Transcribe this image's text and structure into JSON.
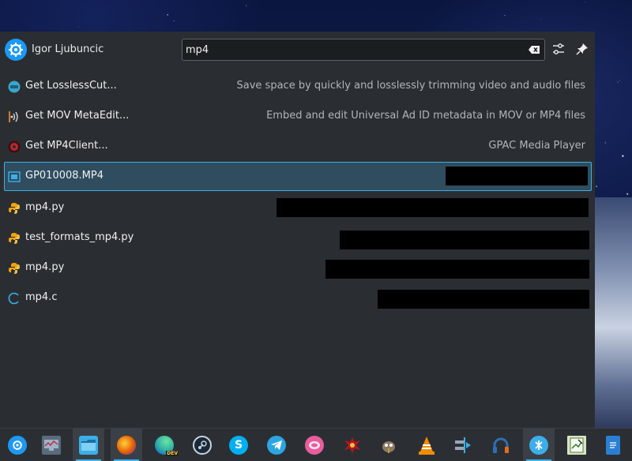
{
  "user": {
    "name": "Igor Ljubuncic"
  },
  "search": {
    "value": "mp4",
    "placeholder": ""
  },
  "results": [
    {
      "title": "Get LosslessCut...",
      "subtitle": "Save space by quickly and losslessly trimming video and audio files",
      "icon": "losslesscut-icon",
      "color": "#3aa6c9"
    },
    {
      "title": "Get MOV MetaEdit...",
      "subtitle": "Embed and edit Universal Ad ID metadata in MOV or MP4 files",
      "icon": "movmetaedit-icon",
      "color": "#8c8f93"
    },
    {
      "title": "Get MP4Client...",
      "subtitle": "GPAC Media Player",
      "icon": "gpac-icon",
      "color": "#c0262d"
    },
    {
      "title": "GP010008.MP4",
      "subtitle": "",
      "icon": "video-file-icon",
      "color": "#3daee9"
    },
    {
      "title": "mp4.py",
      "subtitle": "",
      "icon": "python-file-icon",
      "color": "#f0a30a"
    },
    {
      "title": "test_formats_mp4.py",
      "subtitle": "",
      "icon": "python-file-icon",
      "color": "#f0a30a"
    },
    {
      "title": "mp4.py",
      "subtitle": "",
      "icon": "python-file-icon",
      "color": "#f0a30a"
    },
    {
      "title": "mp4.c",
      "subtitle": "",
      "icon": "c-source-file-icon",
      "color": "#3daee9"
    }
  ],
  "taskbar": [
    {
      "icon": "kde-launcher-icon",
      "color": "#1d99f3",
      "glyph": ""
    },
    {
      "icon": "system-monitor-icon",
      "color": "#5a6b7c",
      "glyph": ""
    },
    {
      "icon": "file-manager-icon",
      "color": "#3daee9",
      "glyph": ""
    },
    {
      "icon": "firefox-icon",
      "color": "#e66000",
      "glyph": ""
    },
    {
      "icon": "edge-dev-icon",
      "color": "#2fb3a5",
      "glyph": "DEV"
    },
    {
      "icon": "steam-icon",
      "color": "#1b2838",
      "glyph": ""
    },
    {
      "icon": "skype-icon",
      "color": "#00aff0",
      "glyph": "S"
    },
    {
      "icon": "telegram-icon",
      "color": "#2ca5e0",
      "glyph": ""
    },
    {
      "icon": "chat-app-icon",
      "color": "#e85d9e",
      "glyph": ""
    },
    {
      "icon": "game-app-icon",
      "color": "#b3161d",
      "glyph": ""
    },
    {
      "icon": "gimp-icon",
      "color": "#6b5b45",
      "glyph": ""
    },
    {
      "icon": "vlc-icon",
      "color": "#f08c00",
      "glyph": ""
    },
    {
      "icon": "kdenlive-icon",
      "color": "#5b6f8a",
      "glyph": ""
    },
    {
      "icon": "headphones-app-icon",
      "color": "#2d6fb3",
      "glyph": ""
    },
    {
      "icon": "kde-connect-icon",
      "color": "#3daee9",
      "glyph": ""
    },
    {
      "icon": "text-editor-icon",
      "color": "#d6e3c5",
      "glyph": ""
    },
    {
      "icon": "document-icon",
      "color": "#2a7fd4",
      "glyph": ""
    }
  ]
}
